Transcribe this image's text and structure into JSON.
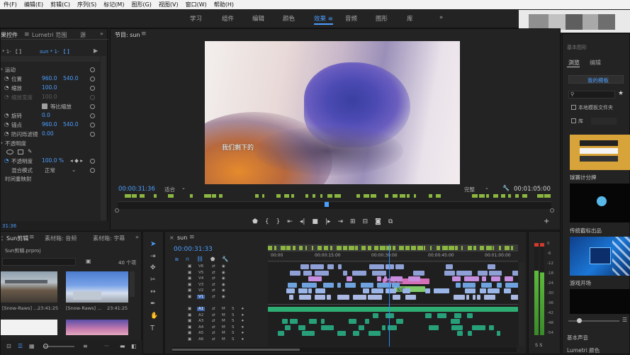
{
  "menu": [
    "件(F)",
    "编辑(E)",
    "剪辑(C)",
    "序列(S)",
    "标记(M)",
    "图形(G)",
    "视图(V)",
    "窗口(W)",
    "帮助(H)"
  ],
  "workspaces": {
    "items": [
      "学习",
      "组件",
      "编辑",
      "颜色",
      "效果",
      "音频",
      "图形",
      "库"
    ],
    "active": "效果",
    "more": "»"
  },
  "effect_controls": {
    "tabs": [
      "果控件",
      "Lumetri 范围",
      "源"
    ],
    "source_label": "* 1- 【 】",
    "clip_label": "sun * 1- 【 】",
    "section_motion": "运动",
    "position_label": "位置",
    "position_x": "960.0",
    "position_y": "540.0",
    "scale_label": "缩放",
    "scale_value": "100.0",
    "scale_width_label": "缩放宽度",
    "scale_width_value": "100.0",
    "uniform_label": "等比缩放",
    "rotation_label": "旋转",
    "rotation_value": "0.0",
    "anchor_label": "锚点",
    "anchor_x": "960.0",
    "anchor_y": "540.0",
    "antiflicker_label": "防闪烁滤镜",
    "antiflicker_value": "0.00",
    "opacity_section": "不透明度",
    "opacity_label": "不透明度",
    "opacity_value": "100.0 %",
    "blend_label": "混合模式",
    "blend_value": "正常",
    "time_remap": "时间重映射",
    "bottom_time": "31:36"
  },
  "program": {
    "tab": "节目: sun",
    "subtitle": "我们剩下的",
    "timecode": "00:00:31:36",
    "fit": "适合",
    "quality": "完整",
    "duration": "00:01:05:00"
  },
  "project": {
    "tabs": [
      "：Sun剪辑",
      "素材箱: 音频",
      "素材箱: 字幕"
    ],
    "file": "Sun剪辑.prproj",
    "count": "40 个项",
    "clips": [
      {
        "name": "[Snow-Raws] ...",
        "dur": "23:41:25"
      },
      {
        "name": "[Snow-Raws] ...",
        "dur": "23:41:25"
      }
    ]
  },
  "timeline": {
    "tab": "sun",
    "timecode": "00:00:31:33",
    "ruler": [
      "00:00",
      "00:00:15:00",
      "00:00:30:00",
      "00:00:45:00",
      "00:01:00:00"
    ],
    "video_tracks": [
      "V6",
      "V5",
      "V4",
      "V3",
      "V2",
      "V1"
    ],
    "audio_tracks": [
      "A1",
      "A2",
      "A3",
      "A4",
      "A5",
      "A6"
    ],
    "clip1": "聚焦模糊",
    "clip2": "投影"
  },
  "meter": {
    "scale": [
      "0",
      "-6",
      "-12",
      "-18",
      "-24",
      "-30",
      "-36",
      "-42",
      "-48",
      "-54"
    ],
    "solo": "S  S"
  },
  "essential_graphics": {
    "header": "基本图形",
    "tabs": [
      "浏览",
      "编辑"
    ],
    "templates_dropdown": "我的模板",
    "local_templates": "本地模板文件夹",
    "library": "库",
    "templates": [
      "球赛计分牌",
      "传统截标出品",
      "游戏开场"
    ],
    "bottom1": "基本声音",
    "bottom2": "Lumetri 颜色"
  },
  "colors": {
    "accent": "#4c9eff",
    "playhead": "#2a8cff",
    "time_yellow": "#e8c547",
    "green_track": "#8ac240"
  }
}
